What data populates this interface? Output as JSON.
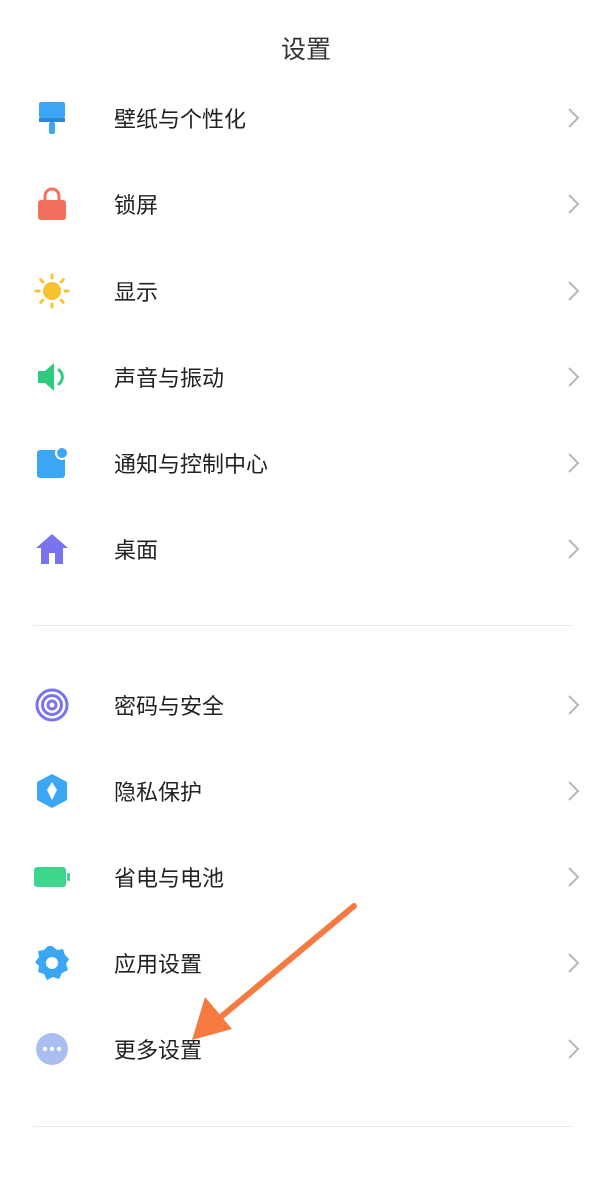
{
  "header": {
    "title": "设置"
  },
  "group1": [
    {
      "label": "壁纸与个性化",
      "icon": "brush-icon",
      "color": "#3ba6f3"
    },
    {
      "label": "锁屏",
      "icon": "lock-icon",
      "color": "#f36f5e"
    },
    {
      "label": "显示",
      "icon": "sun-icon",
      "color": "#f7c22f"
    },
    {
      "label": "声音与振动",
      "icon": "speaker-icon",
      "color": "#2ecb7e"
    },
    {
      "label": "通知与控制中心",
      "icon": "notification-icon",
      "color": "#3ba6f3"
    },
    {
      "label": "桌面",
      "icon": "home-icon",
      "color": "#7a73f0"
    }
  ],
  "group2": [
    {
      "label": "密码与安全",
      "icon": "fingerprint-icon",
      "color": "#7a73f0"
    },
    {
      "label": "隐私保护",
      "icon": "privacy-shield-icon",
      "color": "#3ba6f3"
    },
    {
      "label": "省电与电池",
      "icon": "battery-icon",
      "color": "#3dd68c"
    },
    {
      "label": "应用设置",
      "icon": "gear-icon",
      "color": "#3ba6f3"
    },
    {
      "label": "更多设置",
      "icon": "more-dots-icon",
      "color": "#a9bdf0"
    }
  ],
  "annotation": {
    "arrow_color": "#f47a40"
  }
}
